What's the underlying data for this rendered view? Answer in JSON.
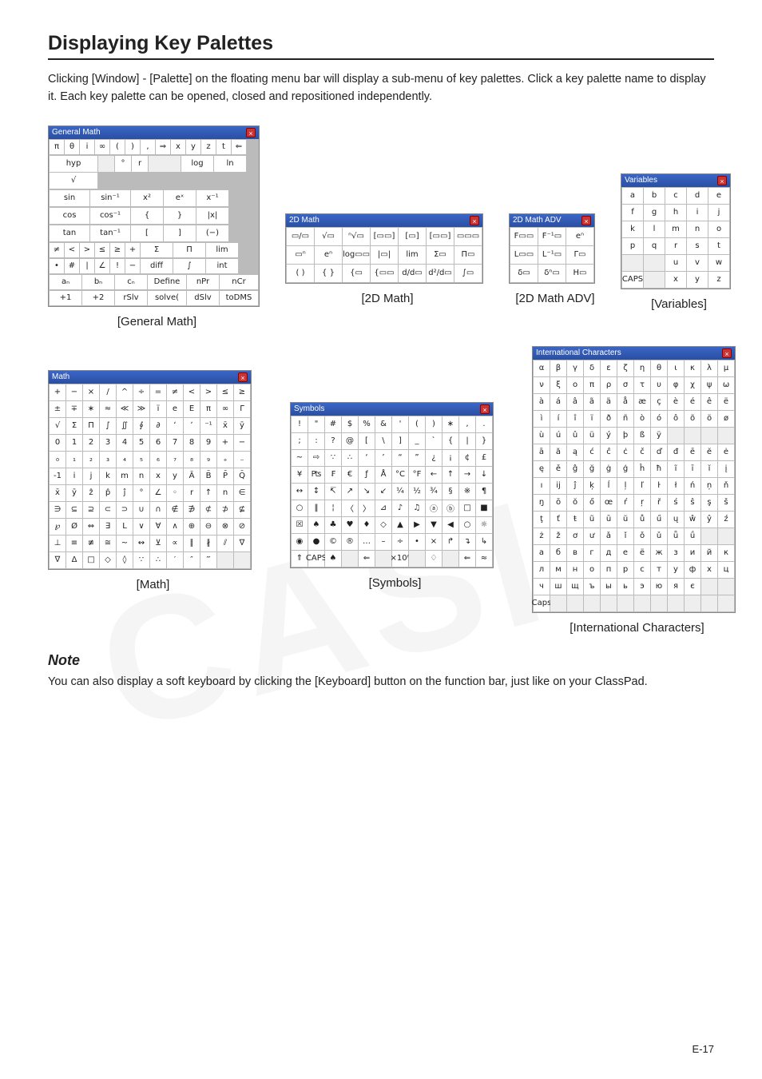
{
  "page": {
    "number": "E-17"
  },
  "heading": "Displaying Key Palettes",
  "lead": "Clicking [Window] - [Palette] on the floating menu bar will display a sub-menu of key palettes. Click a key palette name to display it. Each key palette can be opened, closed and repositioned independently.",
  "note": {
    "heading": "Note",
    "body": "You can also display a soft keyboard by clicking the [Keyboard] button on the function bar, just like on your ClassPad."
  },
  "captions": {
    "gm": "[General Math]",
    "tdm": "[2D Math]",
    "tdadv": "[2D Math ADV]",
    "vars": "[Variables]",
    "math": "[Math]",
    "sym": "[Symbols]",
    "intc": "[International Characters]"
  },
  "palettes": {
    "gm": {
      "title": "General Math",
      "r1": [
        "π",
        "θ",
        "i",
        "∞",
        "(",
        ")",
        ",",
        "⇒",
        "x",
        "y",
        "z",
        "t",
        "⇐"
      ],
      "r2": [
        "hyp",
        "",
        "°",
        "r",
        "",
        "log",
        "ln",
        "√"
      ],
      "r3a": [
        "sin",
        "sin⁻¹",
        "x²",
        "eˣ",
        "x⁻¹"
      ],
      "r3b": [
        "cos",
        "cos⁻¹",
        "{",
        "}",
        "|x|"
      ],
      "r3c": [
        "tan",
        "tan⁻¹",
        "[",
        "]",
        "(−)"
      ],
      "r4a": [
        "≠",
        "<",
        ">",
        "≤",
        "≥",
        "+",
        "Σ",
        "Π",
        "lim"
      ],
      "r4b": [
        "•",
        "#",
        "|",
        "∠",
        "!",
        "−",
        "diff",
        "∫",
        "int"
      ],
      "r5a": [
        "aₙ",
        "bₙ",
        "cₙ",
        "Define",
        "nPr",
        "nCr"
      ],
      "r5b": [
        "+1",
        "+2",
        "rSlv",
        "solve(",
        "dSlv",
        "toDMS"
      ]
    },
    "tdm": {
      "title": "2D Math",
      "rows": [
        [
          "▭/▭",
          "√▭",
          "ⁿ√▭",
          "[▭▭]",
          "[▭]",
          "[▭▭]",
          "▭▭▭"
        ],
        [
          "▭ⁿ",
          "eⁿ",
          "log▭▭",
          "|▭|",
          "lim",
          "Σ▭",
          "Π▭"
        ],
        [
          "( )",
          "{ }",
          "{▭",
          "{▭▭",
          "d/d▭",
          "d²/d▭",
          "∫▭"
        ]
      ]
    },
    "tdadv": {
      "title": "2D Math ADV",
      "rows": [
        [
          "F▭▭",
          "F⁻¹▭",
          "eⁿ"
        ],
        [
          "L▭▭",
          "L⁻¹▭",
          "Γ▭"
        ],
        [
          "δ▭",
          "δⁿ▭",
          "H▭"
        ]
      ]
    },
    "vars": {
      "title": "Variables",
      "rows": [
        [
          "a",
          "b",
          "c",
          "d",
          "e"
        ],
        [
          "f",
          "g",
          "h",
          "i",
          "j"
        ],
        [
          "k",
          "l",
          "m",
          "n",
          "o"
        ],
        [
          "p",
          "q",
          "r",
          "s",
          "t"
        ],
        [
          "",
          "",
          "u",
          "v",
          "w"
        ],
        [
          "CAPS",
          "",
          "x",
          "y",
          "z"
        ]
      ]
    },
    "math": {
      "title": "Math",
      "rows": [
        [
          "+",
          "−",
          "×",
          "/",
          "^",
          "÷",
          "=",
          "≠",
          "<",
          ">",
          "≤",
          "≥"
        ],
        [
          "±",
          "∓",
          "∗",
          "≈",
          "≪",
          "≫",
          "ï",
          "e",
          "E",
          "π",
          "∞",
          "Γ"
        ],
        [
          "√",
          "Σ",
          "Π",
          "∫",
          "∬",
          "∮",
          "∂",
          "ʻ",
          "ʼ",
          "⁻¹",
          "x̄",
          "ȳ"
        ],
        [
          "0",
          "1",
          "2",
          "3",
          "4",
          "5",
          "6",
          "7",
          "8",
          "9",
          "+",
          "−"
        ],
        [
          "₀",
          "₁",
          "₂",
          "₃",
          "₄",
          "₅",
          "₆",
          "₇",
          "₈",
          "₉",
          "₊",
          "₋"
        ],
        [
          "-1",
          "i",
          "j",
          "k",
          "m",
          "n",
          "x",
          "y",
          "Ā",
          "B̄",
          "P̄",
          "Q̄"
        ],
        [
          "x̄",
          "ȳ",
          "ẑ",
          "p̂",
          "ĵ",
          "°",
          "∠",
          "◦",
          "r",
          "↑",
          "n",
          "∈"
        ],
        [
          "∋",
          "⊆",
          "⊇",
          "⊂",
          "⊃",
          "∪",
          "∩",
          "∉",
          "∌",
          "⊄",
          "⊅",
          "⊈"
        ],
        [
          "℘",
          "Ø",
          "⇔",
          "∃",
          "L",
          "∨",
          "∀",
          "∧",
          "⊕",
          "⊖",
          "⊗",
          "⊘"
        ],
        [
          "⊥",
          "≡",
          "≢",
          "≅",
          "~",
          "↭",
          "⊻",
          "∝",
          "∥",
          "∦",
          "⫽",
          "∇"
        ],
        [
          "∇",
          "Δ",
          "□",
          "◇",
          "◊",
          "∵",
          "∴",
          "′",
          "″",
          "‴",
          "",
          ""
        ]
      ]
    },
    "sym": {
      "title": "Symbols",
      "rows": [
        [
          "!",
          "\"",
          "#",
          "$",
          "%",
          "&",
          "'",
          "(",
          ")",
          "∗",
          ",",
          "."
        ],
        [
          ";",
          ":",
          "?",
          "@",
          "[",
          "\\",
          "]",
          "_",
          "`",
          "{",
          "|",
          "}"
        ],
        [
          "~",
          "⇨",
          "∵",
          "∴",
          "‘",
          "’",
          "“",
          "”",
          "¿",
          "¡",
          "¢",
          "£"
        ],
        [
          "¥",
          "₧",
          "₣",
          "€",
          "ƒ",
          "Å",
          "°C",
          "°F",
          "←",
          "↑",
          "→",
          "↓"
        ],
        [
          "↔",
          "↕",
          "↸",
          "↗",
          "↘",
          "↙",
          "¼",
          "½",
          "¾",
          "§",
          "※",
          "¶"
        ],
        [
          "○",
          "‖",
          "¦",
          "〈",
          "〉",
          "⊿",
          "♪",
          "♫",
          "ⓐ",
          "ⓑ",
          "□",
          "■"
        ],
        [
          "☒",
          "♠",
          "♣",
          "♥",
          "♦",
          "◇",
          "▲",
          "▶",
          "▼",
          "◀",
          "○",
          "☼"
        ],
        [
          "◉",
          "●",
          "©",
          "®",
          "…",
          "–",
          "÷",
          "•",
          "×",
          "↱",
          "↴",
          "↳"
        ],
        [
          "⇑",
          "CAPS",
          "♠",
          "",
          "⇐",
          "",
          "×10ⁿ",
          "",
          "♢",
          "",
          "⇐",
          "≈"
        ]
      ]
    },
    "intc": {
      "title": "International Characters",
      "rows": [
        [
          "α",
          "β",
          "γ",
          "δ",
          "ε",
          "ζ",
          "η",
          "θ",
          "ι",
          "κ",
          "λ",
          "μ"
        ],
        [
          "ν",
          "ξ",
          "ο",
          "π",
          "ρ",
          "σ",
          "τ",
          "υ",
          "φ",
          "χ",
          "ψ",
          "ω"
        ],
        [
          "à",
          "á",
          "â",
          "ã",
          "ä",
          "å",
          "æ",
          "ç",
          "è",
          "é",
          "ê",
          "ë"
        ],
        [
          "ì",
          "í",
          "î",
          "ï",
          "ð",
          "ñ",
          "ò",
          "ó",
          "ô",
          "õ",
          "ö",
          "ø"
        ],
        [
          "ù",
          "ú",
          "û",
          "ü",
          "ý",
          "þ",
          "ß",
          "ÿ",
          "",
          "",
          "",
          ""
        ],
        [
          "ā",
          "ă",
          "ą",
          "ć",
          "ĉ",
          "ċ",
          "č",
          "ď",
          "đ",
          "ē",
          "ĕ",
          "ė"
        ],
        [
          "ę",
          "ě",
          "ĝ",
          "ğ",
          "ġ",
          "ģ",
          "ĥ",
          "ħ",
          "ĩ",
          "ī",
          "ĭ",
          "į"
        ],
        [
          "ı",
          "ĳ",
          "ĵ",
          "ķ",
          "ĺ",
          "ļ",
          "ľ",
          "ŀ",
          "ł",
          "ń",
          "ņ",
          "ň"
        ],
        [
          "ŋ",
          "ō",
          "ŏ",
          "ő",
          "œ",
          "ŕ",
          "ŗ",
          "ř",
          "ś",
          "ŝ",
          "ş",
          "š"
        ],
        [
          "ţ",
          "ť",
          "ŧ",
          "ũ",
          "ū",
          "ŭ",
          "ů",
          "ű",
          "ų",
          "ŵ",
          "ŷ",
          "ź"
        ],
        [
          "ż",
          "ž",
          "ơ",
          "ư",
          "ǎ",
          "ǐ",
          "ǒ",
          "ǔ",
          "ǖ",
          "ǘ",
          "",
          ""
        ],
        [
          "а",
          "б",
          "в",
          "г",
          "д",
          "е",
          "ё",
          "ж",
          "з",
          "и",
          "й",
          "к"
        ],
        [
          "л",
          "м",
          "н",
          "о",
          "п",
          "р",
          "с",
          "т",
          "у",
          "ф",
          "х",
          "ц"
        ],
        [
          "ч",
          "ш",
          "щ",
          "ъ",
          "ы",
          "ь",
          "э",
          "ю",
          "я",
          "є",
          "",
          ""
        ],
        [
          "Caps",
          "",
          "",
          "",
          "",
          "",
          "",
          "",
          "",
          "",
          "",
          ""
        ]
      ]
    }
  }
}
